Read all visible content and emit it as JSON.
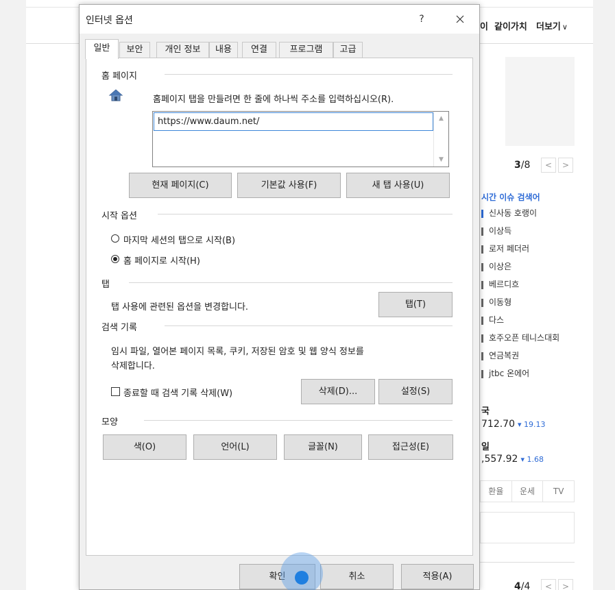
{
  "background": {
    "nav": {
      "partial_char": "이",
      "item": "같이가치",
      "more": "더보기"
    },
    "pager_top": {
      "current": "3",
      "total": "/8"
    },
    "trending": {
      "title": "시간 이슈 검색어",
      "items": [
        "신사동 호랭이",
        "이상득",
        "로저 페더러",
        "이상은",
        "베르디흐",
        "이동형",
        "다스",
        "호주오픈 테니스대회",
        "연금복권",
        "jtbc 온에어"
      ]
    },
    "stocks": [
      {
        "name": "국",
        "value": "712.70",
        "change": "19.13"
      },
      {
        "name": "일",
        "value": ",557.92",
        "change": "1.68"
      }
    ],
    "tabs": [
      "환율",
      "운세",
      "TV"
    ],
    "pager_bottom": {
      "current": "4",
      "total": "/4"
    }
  },
  "dialog": {
    "title": "인터넷 옵션",
    "help": "?",
    "tabs": [
      "일반",
      "보안",
      "개인 정보",
      "내용",
      "연결",
      "프로그램",
      "고급"
    ],
    "home": {
      "title": "홈 페이지",
      "instruction": "홈페이지 탭을 만들려면 한 줄에 하나씩 주소를 입력하십시오(R).",
      "url": "https://www.daum.net/",
      "btn_current": "현재 페이지(C)",
      "btn_default": "기본값 사용(F)",
      "btn_newtab": "새 탭 사용(U)"
    },
    "startup": {
      "title": "시작 옵션",
      "option_last_session": "마지막 세션의 탭으로 시작(B)",
      "option_home": "홈 페이지로 시작(H)",
      "selected": "option_home"
    },
    "tabs_group": {
      "title": "탭",
      "description": "탭 사용에 관련된 옵션을 변경합니다.",
      "button": "탭(T)"
    },
    "history": {
      "title": "검색 기록",
      "description_line1": "임시 파일, 열어본 페이지 목록, 쿠키, 저장된 암호 및 웹 양식 정보를",
      "description_line2": "삭제합니다.",
      "checkbox_label": "종료할 때 검색 기록 삭제(W)",
      "checkbox_checked": false,
      "btn_delete": "삭제(D)...",
      "btn_settings": "설정(S)"
    },
    "appearance": {
      "title": "모양",
      "btn_colors": "색(O)",
      "btn_languages": "언어(L)",
      "btn_fonts": "글꼴(N)",
      "btn_accessibility": "접근성(E)"
    },
    "footer": {
      "ok": "확인",
      "cancel": "취소",
      "apply": "적용(A)"
    }
  }
}
